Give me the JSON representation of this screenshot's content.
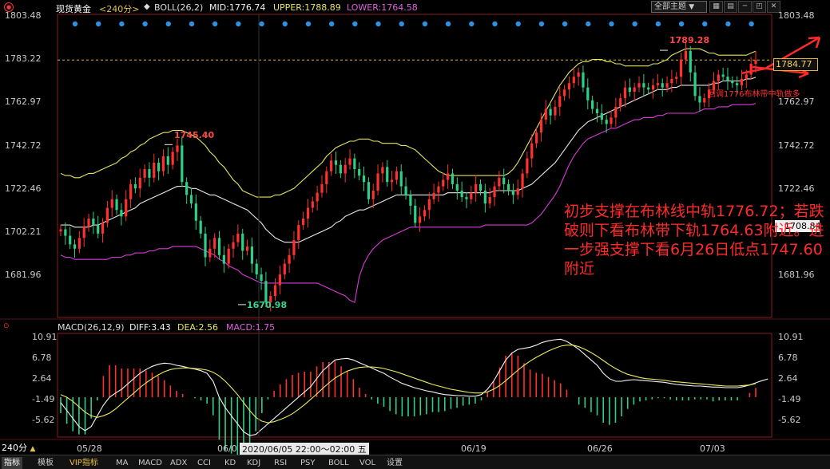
{
  "header": {
    "instrument": "现货黄金",
    "period": "<240分>",
    "boll_label": "BOLL(26,2)",
    "mid": "MID:1776.74",
    "upper": "UPPER:1788.89",
    "lower": "LOWER:1764.58",
    "theme_select": "全部主题",
    "theme_arrow": "▼"
  },
  "price_axis": {
    "ticks": [
      "1803.48",
      "1783.22",
      "1762.97",
      "1742.72",
      "1722.46",
      "1702.21",
      "1681.96"
    ],
    "ticks_right": [
      "1803.48",
      "1762.97",
      "1742.72",
      "1722.46",
      "1681.96"
    ]
  },
  "price_tags": {
    "current": "1784.77",
    "crosshair": "1708.84"
  },
  "price_labels": {
    "high": "1789.28",
    "peak": "1745.40",
    "low": "1670.98"
  },
  "annotations": {
    "small": "回调1776布林带中轨做多",
    "big": "初步支撑在布林线中轨1776.72；若跌破则下看布林带下轨1764.63附近。进一步强支撑下看6月26日低点1747.60附近"
  },
  "macd_header": {
    "label": "MACD(26,12,9)",
    "diff": "DIFF:3.43",
    "dea": "DEA:2.56",
    "macd": "MACD:1.75"
  },
  "macd_axis": {
    "ticks": [
      "10.91",
      "6.78",
      "2.64",
      "-1.49",
      "-5.62"
    ]
  },
  "x_axis": {
    "period_button": "240分",
    "up_arrow": "▲",
    "labels": [
      "05/28",
      "06/0",
      "2020/06/05 22:00～02:00 五",
      "06/19",
      "06/26",
      "07/03"
    ]
  },
  "bottom_tabs": [
    "指标",
    "模板",
    "VIP指标",
    "MA",
    "MACD",
    "ADX",
    "CCI",
    "KD",
    "KDJ",
    "RSI",
    "PSY",
    "BOLL",
    "VOL",
    "设置"
  ],
  "colors": {
    "up": "#ff3030",
    "down": "#2ecf86",
    "mid_band": "#e8e8e8",
    "upper_band": "#e4e461",
    "lower_band": "#d83ad8",
    "macd_diff": "#f4f4f4",
    "macd_dea": "#ecec5c",
    "accent": "#ff2a2a"
  },
  "chart_data": [
    {
      "type": "line",
      "subtype": "candlestick with Bollinger Bands",
      "title": "现货黄金 <240分>",
      "y_ticks": [
        1803.48,
        1783.22,
        1762.97,
        1742.72,
        1722.46,
        1702.21,
        1681.96
      ],
      "ylim": [
        1665,
        1806
      ],
      "x_labels": [
        "05/28",
        "06/0",
        "06/19",
        "06/26",
        "07/03"
      ],
      "close": [
        1706,
        1703,
        1699,
        1697,
        1702,
        1707,
        1711,
        1708,
        1704,
        1709,
        1716,
        1720,
        1715,
        1712,
        1720,
        1727,
        1725,
        1730,
        1734,
        1730,
        1737,
        1733,
        1740,
        1736,
        1742,
        1745,
        1728,
        1722,
        1718,
        1710,
        1704,
        1693,
        1697,
        1702,
        1694,
        1690,
        1697,
        1700,
        1704,
        1696,
        1698,
        1690,
        1685,
        1682,
        1672,
        1675,
        1680,
        1685,
        1690,
        1694,
        1701,
        1708,
        1711,
        1716,
        1719,
        1723,
        1727,
        1733,
        1738,
        1736,
        1732,
        1736,
        1739,
        1734,
        1731,
        1728,
        1720,
        1724,
        1732,
        1735,
        1728,
        1729,
        1733,
        1726,
        1722,
        1717,
        1709,
        1712,
        1715,
        1720,
        1723,
        1726,
        1729,
        1732,
        1727,
        1724,
        1721,
        1720,
        1723,
        1727,
        1724,
        1718,
        1721,
        1726,
        1730,
        1727,
        1724,
        1722,
        1725,
        1732,
        1739,
        1746,
        1751,
        1757,
        1762,
        1759,
        1763,
        1768,
        1771,
        1774,
        1777,
        1779,
        1772,
        1766,
        1762,
        1760,
        1757,
        1755,
        1758,
        1763,
        1767,
        1772,
        1770,
        1772,
        1774,
        1772,
        1771,
        1773,
        1774,
        1772,
        1774,
        1776,
        1777,
        1785,
        1789,
        1779,
        1768,
        1765,
        1767,
        1771,
        1775,
        1778,
        1777,
        1775,
        1774,
        1773,
        1776,
        1778,
        1783,
        1784.77
      ],
      "series": [
        {
          "name": "MID",
          "values": [
            1708,
            1708,
            1708,
            1707,
            1707,
            1707,
            1707,
            1708,
            1708,
            1709,
            1710,
            1711,
            1712,
            1713,
            1714,
            1715,
            1716,
            1718,
            1719,
            1720,
            1721,
            1722,
            1723,
            1724,
            1725,
            1726,
            1726,
            1726,
            1725,
            1725,
            1724,
            1723,
            1722,
            1722,
            1721,
            1720,
            1719,
            1718,
            1717,
            1716,
            1715,
            1713,
            1711,
            1709,
            1706,
            1704,
            1702,
            1701,
            1700,
            1700,
            1700,
            1700,
            1701,
            1702,
            1703,
            1704,
            1705,
            1706,
            1707,
            1709,
            1710,
            1712,
            1713,
            1714,
            1715,
            1715,
            1716,
            1717,
            1718,
            1719,
            1720,
            1721,
            1722,
            1722,
            1722,
            1722,
            1722,
            1722,
            1722,
            1722,
            1722,
            1722,
            1722,
            1723,
            1723,
            1723,
            1723,
            1723,
            1723,
            1723,
            1723,
            1723,
            1723,
            1724,
            1724,
            1724,
            1724,
            1724,
            1724,
            1725,
            1726,
            1727,
            1729,
            1731,
            1733,
            1735,
            1737,
            1740,
            1743,
            1746,
            1749,
            1752,
            1754,
            1756,
            1757,
            1758,
            1759,
            1760,
            1761,
            1762,
            1763,
            1764,
            1765,
            1766,
            1767,
            1768,
            1769,
            1770,
            1771,
            1771,
            1771,
            1772,
            1772,
            1773,
            1773,
            1773,
            1773,
            1773,
            1773,
            1773,
            1774,
            1774,
            1775,
            1775,
            1775,
            1775,
            1775,
            1776,
            1776,
            1776.74
          ]
        },
        {
          "name": "UPPER",
          "values": [
            1732,
            1731,
            1731,
            1730,
            1730,
            1731,
            1732,
            1732,
            1733,
            1734,
            1735,
            1736,
            1737,
            1739,
            1740,
            1742,
            1743,
            1745,
            1746,
            1748,
            1749,
            1750,
            1751,
            1751,
            1752,
            1752,
            1752,
            1751,
            1750,
            1749,
            1747,
            1745,
            1742,
            1740,
            1737,
            1735,
            1732,
            1729,
            1727,
            1724,
            1723,
            1722,
            1721,
            1721,
            1721,
            1721,
            1722,
            1722,
            1723,
            1724,
            1725,
            1727,
            1729,
            1731,
            1733,
            1735,
            1737,
            1740,
            1742,
            1744,
            1745,
            1746,
            1747,
            1747,
            1748,
            1748,
            1748,
            1747,
            1747,
            1746,
            1746,
            1746,
            1746,
            1745,
            1745,
            1744,
            1743,
            1741,
            1739,
            1737,
            1735,
            1733,
            1732,
            1731,
            1731,
            1731,
            1731,
            1731,
            1731,
            1731,
            1731,
            1731,
            1731,
            1731,
            1731,
            1731,
            1732,
            1734,
            1737,
            1741,
            1745,
            1749,
            1753,
            1757,
            1761,
            1765,
            1769,
            1773,
            1776,
            1779,
            1781,
            1783,
            1784,
            1784,
            1785,
            1785,
            1785,
            1784,
            1784,
            1783,
            1783,
            1782,
            1782,
            1782,
            1782,
            1782,
            1782,
            1783,
            1783,
            1784,
            1785,
            1787,
            1788,
            1789,
            1790,
            1790,
            1790,
            1790,
            1789,
            1788,
            1788,
            1787,
            1787,
            1787,
            1787,
            1787,
            1787,
            1787,
            1788,
            1788.89
          ]
        },
        {
          "name": "LOWER",
          "values": [
            1694,
            1693,
            1693,
            1692,
            1692,
            1692,
            1692,
            1692,
            1692,
            1692,
            1692,
            1693,
            1693,
            1693,
            1694,
            1694,
            1695,
            1695,
            1695,
            1696,
            1696,
            1697,
            1697,
            1697,
            1698,
            1698,
            1698,
            1698,
            1698,
            1698,
            1697,
            1696,
            1695,
            1694,
            1692,
            1691,
            1689,
            1688,
            1687,
            1685,
            1684,
            1683,
            1682,
            1681,
            1681,
            1681,
            1681,
            1681,
            1681,
            1681,
            1681,
            1681,
            1681,
            1681,
            1681,
            1681,
            1680,
            1679,
            1678,
            1677,
            1676,
            1675,
            1673,
            1672,
            1684,
            1690,
            1694,
            1697,
            1699,
            1701,
            1702,
            1703,
            1704,
            1705,
            1706,
            1707,
            1707,
            1707,
            1707,
            1707,
            1707,
            1707,
            1707,
            1707,
            1707,
            1707,
            1707,
            1707,
            1707,
            1707,
            1707,
            1708,
            1708,
            1708,
            1708,
            1708,
            1708,
            1708,
            1708,
            1708,
            1708,
            1709,
            1711,
            1713,
            1716,
            1719,
            1722,
            1726,
            1731,
            1736,
            1740,
            1743,
            1746,
            1748,
            1749,
            1750,
            1751,
            1752,
            1753,
            1753,
            1754,
            1755,
            1756,
            1757,
            1757,
            1758,
            1758,
            1758,
            1759,
            1759,
            1760,
            1760,
            1760,
            1760,
            1760,
            1760,
            1760,
            1761,
            1762,
            1762,
            1762,
            1763,
            1763,
            1763,
            1764,
            1764,
            1764,
            1764,
            1764,
            1764.58
          ]
        }
      ]
    },
    {
      "type": "bar",
      "subtype": "MACD histogram with DIFF/DEA lines",
      "title": "MACD(26,12,9)",
      "y_ticks": [
        10.91,
        6.78,
        2.64,
        -1.49,
        -5.62
      ],
      "ylim": [
        -7.5,
        12
      ],
      "series": [
        {
          "name": "DIFF",
          "values": [
            -1,
            -2.5,
            -4,
            -5.5,
            -6.3,
            -5.5,
            -3.5,
            -1.5,
            0,
            0.8,
            1.5,
            2.5,
            3.5,
            4.5,
            5.2,
            5.8,
            6.2,
            6.4,
            6.3,
            6.0,
            5.8,
            5.5,
            5.3,
            5.0,
            4.5,
            3,
            0,
            -2,
            -3.5,
            -5,
            -6.5,
            -7.2,
            -7,
            -6,
            -5,
            -4,
            -3,
            -2,
            -1,
            0,
            1,
            2,
            3.5,
            5,
            6,
            7,
            7.2,
            7.3,
            7,
            6.5,
            6.0,
            5.5,
            5.0,
            4.5,
            3.8,
            3.2,
            2.6,
            2.2,
            1.8,
            1.5,
            1.2,
            1.0,
            0.7,
            0.5,
            0.4,
            0.3,
            0.3,
            0.2,
            0.2,
            0.5,
            1.5,
            3,
            5,
            7,
            8.3,
            9.0,
            9.2,
            9.4,
            9.8,
            10.3,
            10.6,
            10.8,
            10.91,
            10.5,
            9.8,
            9,
            8,
            7,
            6,
            4.5,
            3.5,
            3,
            3,
            3.2,
            3.3,
            3.2,
            3.1,
            3,
            2.9,
            2.8,
            2.6,
            2.4,
            2.3,
            2.2,
            2.1,
            2.1,
            2.0,
            1.9,
            1.9,
            1.8,
            1.8,
            1.8,
            2.0,
            2.3,
            2.7,
            3.1,
            3.43
          ]
        },
        {
          "name": "DEA",
          "values": [
            0.5,
            0,
            -0.8,
            -1.8,
            -2.8,
            -3.5,
            -3.8,
            -3.5,
            -3.0,
            -2.2,
            -1.2,
            -0.2,
            0.8,
            1.8,
            2.7,
            3.5,
            4.2,
            4.8,
            5.2,
            5.4,
            5.5,
            5.5,
            5.4,
            5.3,
            5.1,
            4.7,
            4.0,
            3.0,
            1.8,
            0.5,
            -1,
            -2.5,
            -3.8,
            -4.5,
            -4.8,
            -4.6,
            -4.2,
            -3.7,
            -3.1,
            -2.3,
            -1.4,
            -0.4,
            0.6,
            1.7,
            2.7,
            3.6,
            4.3,
            4.9,
            5.3,
            5.6,
            5.7,
            5.7,
            5.6,
            5.4,
            5.1,
            4.8,
            4.4,
            4.0,
            3.6,
            3.2,
            2.8,
            2.4,
            2.1,
            1.8,
            1.5,
            1.3,
            1.1,
            0.9,
            0.8,
            0.8,
            1.0,
            1.5,
            2.2,
            3.1,
            4.1,
            5.1,
            6.0,
            6.8,
            7.5,
            8.1,
            8.7,
            9.2,
            9.6,
            9.8,
            9.8,
            9.5,
            9.0,
            8.4,
            7.7,
            6.9,
            6.1,
            5.4,
            4.8,
            4.3,
            4.0,
            3.7,
            3.5,
            3.4,
            3.3,
            3.2,
            3.0,
            2.9,
            2.8,
            2.7,
            2.6,
            2.5,
            2.4,
            2.3,
            2.2,
            2.1,
            2.1,
            2.1,
            2.2,
            2.3,
            2.56
          ]
        },
        {
          "name": "MACD",
          "values": [
            -3,
            -5,
            -6.4,
            -7,
            -7,
            -4,
            -0.6,
            4,
            6,
            6,
            5.4,
            5.4,
            5.4,
            5.4,
            5,
            4.6,
            4,
            3.2,
            2.2,
            1.2,
            0.6,
            0,
            -0.2,
            -0.6,
            -1.2,
            -3.4,
            -8,
            -10,
            -10.6,
            -11,
            -11,
            -9.4,
            -6.4,
            -3,
            -0.4,
            1.2,
            2.4,
            3.4,
            4.2,
            4.6,
            4.8,
            4.8,
            5.8,
            6.6,
            6.6,
            6.8,
            5.8,
            4.8,
            3.4,
            1.8,
            0.6,
            -0.4,
            -1.2,
            -1.8,
            -2.6,
            -3.2,
            -3.6,
            -3.6,
            -3.6,
            -3.4,
            -3.2,
            -2.8,
            -2.8,
            -2.6,
            -2.2,
            -2,
            -1.6,
            -1.4,
            -1.2,
            -0.6,
            1,
            3,
            5.6,
            7.8,
            8.4,
            7.8,
            6.4,
            5.2,
            4.6,
            4.4,
            3.8,
            3.2,
            2.6,
            1.4,
            0,
            -1.4,
            -2,
            -2.8,
            -3.4,
            -4.8,
            -5.2,
            -4.8,
            -3.6,
            -2.2,
            -1.4,
            -0.8,
            -0.6,
            -0.4,
            -0.2,
            -0.2,
            -0.4,
            -0.6,
            -0.6,
            -0.6,
            -0.4,
            -0.4,
            -0.4,
            -0.8,
            -0.6,
            -0.6,
            -0.6,
            -0.6,
            0,
            0.8,
            1.75
          ]
        }
      ]
    }
  ]
}
